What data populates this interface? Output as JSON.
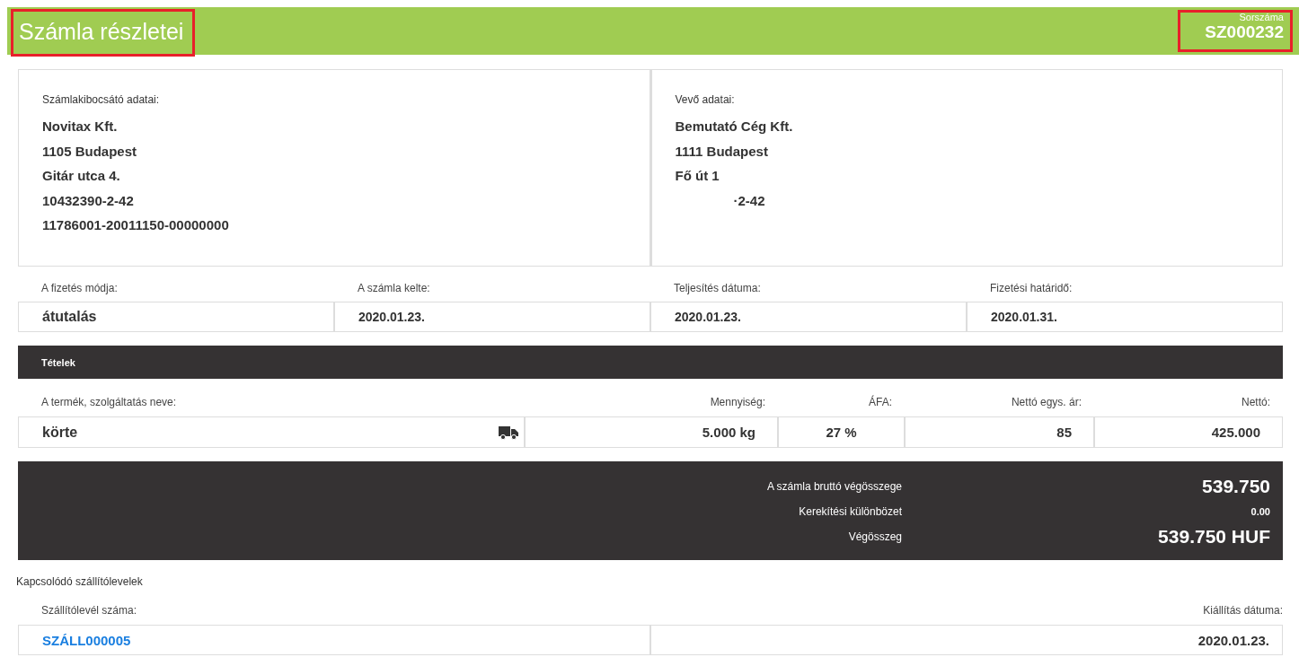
{
  "header": {
    "title": "Számla részletei",
    "title_highlighted": true,
    "number_label": "Sorszáma",
    "number": "SZ000232",
    "number_highlighted": true
  },
  "parties": [
    {
      "label": "Számlakibocsátó adatai:",
      "lines": [
        {
          "text": "Novitax Kft.",
          "masked": false
        },
        {
          "text": "1105 Budapest",
          "masked": false
        },
        {
          "text": "Gitár utca 4.",
          "masked": false
        },
        {
          "text": "10432390-2-42",
          "masked": false
        },
        {
          "text": "11786001-20011150-00000000",
          "masked": false
        }
      ]
    },
    {
      "label": "Vevő adatai:",
      "lines": [
        {
          "text": "Bemutató Cég Kft.",
          "masked": false
        },
        {
          "text": "1111 Budapest",
          "masked": false
        },
        {
          "text": "Fő út 1",
          "masked": false
        },
        {
          "text": "·2-42",
          "masked": true
        }
      ]
    }
  ],
  "payment": [
    {
      "label": "A fizetés módja:",
      "value": "átutalás",
      "large": true
    },
    {
      "label": "A számla kelte:",
      "value": "2020.01.23.",
      "large": false
    },
    {
      "label": "Teljesítés dátuma:",
      "value": "2020.01.23.",
      "large": false
    },
    {
      "label": "Fizetési határidő:",
      "value": "2020.01.31.",
      "large": false
    }
  ],
  "items": {
    "title": "Tételek",
    "columns": [
      "A termék, szolgáltatás neve:",
      "Mennyiség:",
      "ÁFA:",
      "Nettó egys. ár:",
      "Nettó:"
    ],
    "rows": [
      {
        "name": "körte",
        "delivery": true,
        "quantity": "5.000 kg",
        "vat": "27 %",
        "unit_price": "85",
        "net": "425.000"
      }
    ]
  },
  "totals": [
    {
      "label": "A számla bruttó végösszege",
      "value": "539.750",
      "kind": "big"
    },
    {
      "label": "Kerekítési különbözet",
      "value": "0.00",
      "kind": "small"
    },
    {
      "label": "Végösszeg",
      "value": "539.750 HUF",
      "kind": "big"
    }
  ],
  "delivery_notes": {
    "title": "Kapcsolódó szállítólevelek",
    "columns": [
      "Szállítólevél száma:",
      "Kiállítás dátuma:"
    ],
    "rows": [
      {
        "number": "SZÁLL000005",
        "date": "2020.01.23."
      }
    ]
  }
}
